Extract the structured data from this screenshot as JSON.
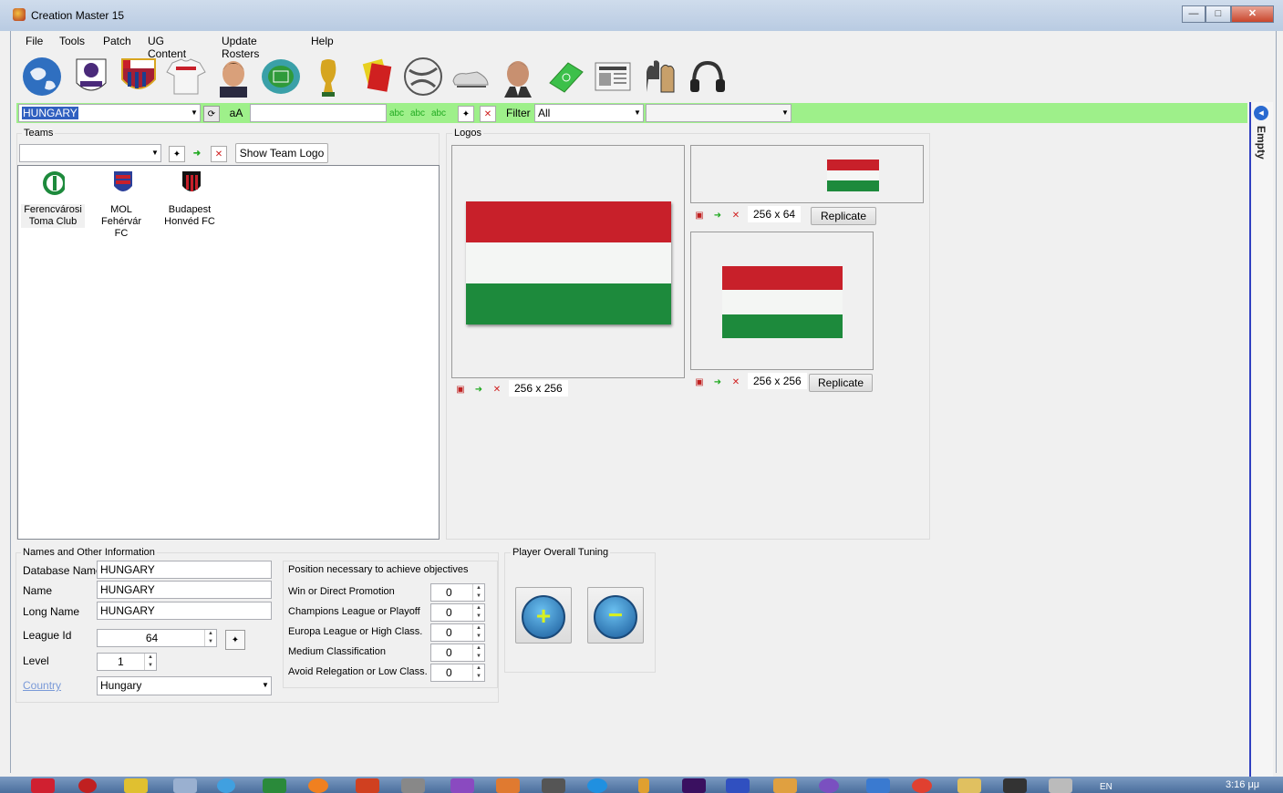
{
  "window": {
    "title": "Creation Master 15",
    "min": "—",
    "max": "□",
    "close": "✕"
  },
  "menu": {
    "items": [
      "File",
      "Tools",
      "Patch",
      "UG Content",
      "Update Rosters",
      "Help"
    ]
  },
  "toolbar": {
    "icons": [
      "globe-icon",
      "premier-league-icon",
      "barcelona-crest-icon",
      "jersey-icon",
      "player-face-icon",
      "stadium-icon",
      "world-cup-trophy-icon",
      "cards-icon",
      "ball-icon",
      "boots-icon",
      "manager-face-icon",
      "pitch-icon",
      "newspaper-icon",
      "gloves-icon",
      "headphones-icon"
    ]
  },
  "filterbar": {
    "country_value": "HUNGARY",
    "case_label": "aA",
    "filter_label": "Filter",
    "filter_value": "All"
  },
  "teams": {
    "group_label": "Teams",
    "show_logo_label": "Show Team Logo",
    "list": [
      {
        "name": "Ferencvárosi\nToma Club",
        "colors": [
          "#1d8a3c",
          "#ffffff"
        ]
      },
      {
        "name": "MOL Fehérvár\nFC",
        "colors": [
          "#2a3f9a",
          "#c8202a"
        ]
      },
      {
        "name": "Budapest\nHonvéd FC",
        "colors": [
          "#c8202a",
          "#111111"
        ]
      }
    ]
  },
  "logos": {
    "group_label": "Logos",
    "large_size": "256 x 256",
    "top_right_size": "256 x 64",
    "bottom_right_size": "256 x 256",
    "replicate_label": "Replicate",
    "flag_colors": {
      "red": "#c8202a",
      "white": "#f4f6f4",
      "green": "#1d8a3c"
    }
  },
  "names": {
    "group_label": "Names and Other Information",
    "database_name_label": "Database Name",
    "database_name_value": "HUNGARY",
    "name_label": "Name",
    "name_value": "HUNGARY",
    "long_name_label": "Long Name",
    "long_name_value": "HUNGARY",
    "league_id_label": "League Id",
    "league_id_value": "64",
    "level_label": "Level",
    "level_value": "1",
    "country_label": "Country",
    "country_value": "Hungary"
  },
  "objectives": {
    "group_label": "Position necessary to achieve objectives",
    "rows": [
      {
        "label": "Win or Direct Promotion",
        "value": "0"
      },
      {
        "label": "Champions League or Playoff",
        "value": "0"
      },
      {
        "label": "Europa League or High Class.",
        "value": "0"
      },
      {
        "label": "Medium Classification",
        "value": "0"
      },
      {
        "label": "Avoid Relegation or Low Class.",
        "value": "0"
      }
    ]
  },
  "tuning": {
    "group_label": "Player Overall Tuning",
    "plus": "+",
    "minus": "−"
  },
  "right_panel": {
    "label": "Empty"
  },
  "taskbar": {
    "lang": "EN",
    "time": "3:16 μμ"
  }
}
